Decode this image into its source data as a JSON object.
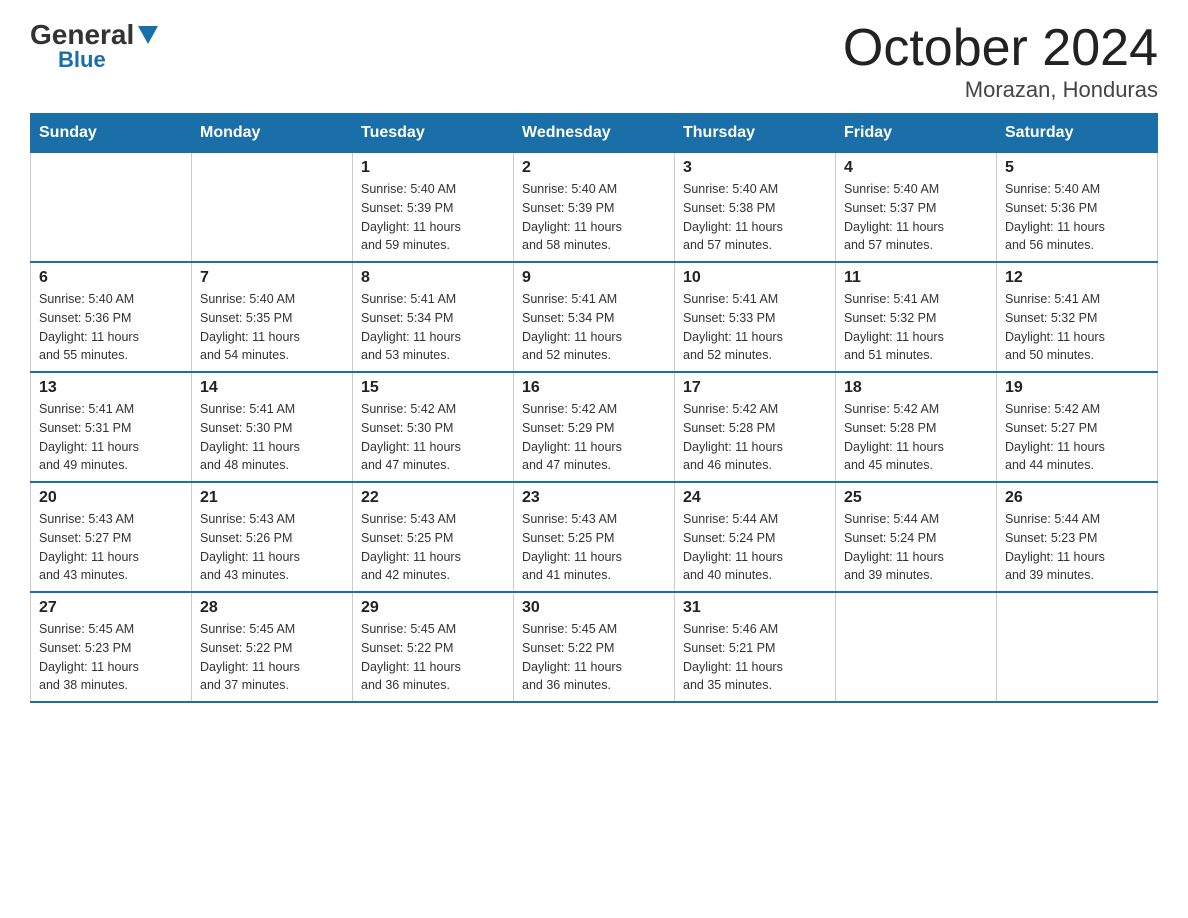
{
  "logo": {
    "general": "General",
    "blue": "Blue"
  },
  "title": "October 2024",
  "location": "Morazan, Honduras",
  "days_of_week": [
    "Sunday",
    "Monday",
    "Tuesday",
    "Wednesday",
    "Thursday",
    "Friday",
    "Saturday"
  ],
  "weeks": [
    [
      {
        "day": "",
        "info": ""
      },
      {
        "day": "",
        "info": ""
      },
      {
        "day": "1",
        "info": "Sunrise: 5:40 AM\nSunset: 5:39 PM\nDaylight: 11 hours\nand 59 minutes."
      },
      {
        "day": "2",
        "info": "Sunrise: 5:40 AM\nSunset: 5:39 PM\nDaylight: 11 hours\nand 58 minutes."
      },
      {
        "day": "3",
        "info": "Sunrise: 5:40 AM\nSunset: 5:38 PM\nDaylight: 11 hours\nand 57 minutes."
      },
      {
        "day": "4",
        "info": "Sunrise: 5:40 AM\nSunset: 5:37 PM\nDaylight: 11 hours\nand 57 minutes."
      },
      {
        "day": "5",
        "info": "Sunrise: 5:40 AM\nSunset: 5:36 PM\nDaylight: 11 hours\nand 56 minutes."
      }
    ],
    [
      {
        "day": "6",
        "info": "Sunrise: 5:40 AM\nSunset: 5:36 PM\nDaylight: 11 hours\nand 55 minutes."
      },
      {
        "day": "7",
        "info": "Sunrise: 5:40 AM\nSunset: 5:35 PM\nDaylight: 11 hours\nand 54 minutes."
      },
      {
        "day": "8",
        "info": "Sunrise: 5:41 AM\nSunset: 5:34 PM\nDaylight: 11 hours\nand 53 minutes."
      },
      {
        "day": "9",
        "info": "Sunrise: 5:41 AM\nSunset: 5:34 PM\nDaylight: 11 hours\nand 52 minutes."
      },
      {
        "day": "10",
        "info": "Sunrise: 5:41 AM\nSunset: 5:33 PM\nDaylight: 11 hours\nand 52 minutes."
      },
      {
        "day": "11",
        "info": "Sunrise: 5:41 AM\nSunset: 5:32 PM\nDaylight: 11 hours\nand 51 minutes."
      },
      {
        "day": "12",
        "info": "Sunrise: 5:41 AM\nSunset: 5:32 PM\nDaylight: 11 hours\nand 50 minutes."
      }
    ],
    [
      {
        "day": "13",
        "info": "Sunrise: 5:41 AM\nSunset: 5:31 PM\nDaylight: 11 hours\nand 49 minutes."
      },
      {
        "day": "14",
        "info": "Sunrise: 5:41 AM\nSunset: 5:30 PM\nDaylight: 11 hours\nand 48 minutes."
      },
      {
        "day": "15",
        "info": "Sunrise: 5:42 AM\nSunset: 5:30 PM\nDaylight: 11 hours\nand 47 minutes."
      },
      {
        "day": "16",
        "info": "Sunrise: 5:42 AM\nSunset: 5:29 PM\nDaylight: 11 hours\nand 47 minutes."
      },
      {
        "day": "17",
        "info": "Sunrise: 5:42 AM\nSunset: 5:28 PM\nDaylight: 11 hours\nand 46 minutes."
      },
      {
        "day": "18",
        "info": "Sunrise: 5:42 AM\nSunset: 5:28 PM\nDaylight: 11 hours\nand 45 minutes."
      },
      {
        "day": "19",
        "info": "Sunrise: 5:42 AM\nSunset: 5:27 PM\nDaylight: 11 hours\nand 44 minutes."
      }
    ],
    [
      {
        "day": "20",
        "info": "Sunrise: 5:43 AM\nSunset: 5:27 PM\nDaylight: 11 hours\nand 43 minutes."
      },
      {
        "day": "21",
        "info": "Sunrise: 5:43 AM\nSunset: 5:26 PM\nDaylight: 11 hours\nand 43 minutes."
      },
      {
        "day": "22",
        "info": "Sunrise: 5:43 AM\nSunset: 5:25 PM\nDaylight: 11 hours\nand 42 minutes."
      },
      {
        "day": "23",
        "info": "Sunrise: 5:43 AM\nSunset: 5:25 PM\nDaylight: 11 hours\nand 41 minutes."
      },
      {
        "day": "24",
        "info": "Sunrise: 5:44 AM\nSunset: 5:24 PM\nDaylight: 11 hours\nand 40 minutes."
      },
      {
        "day": "25",
        "info": "Sunrise: 5:44 AM\nSunset: 5:24 PM\nDaylight: 11 hours\nand 39 minutes."
      },
      {
        "day": "26",
        "info": "Sunrise: 5:44 AM\nSunset: 5:23 PM\nDaylight: 11 hours\nand 39 minutes."
      }
    ],
    [
      {
        "day": "27",
        "info": "Sunrise: 5:45 AM\nSunset: 5:23 PM\nDaylight: 11 hours\nand 38 minutes."
      },
      {
        "day": "28",
        "info": "Sunrise: 5:45 AM\nSunset: 5:22 PM\nDaylight: 11 hours\nand 37 minutes."
      },
      {
        "day": "29",
        "info": "Sunrise: 5:45 AM\nSunset: 5:22 PM\nDaylight: 11 hours\nand 36 minutes."
      },
      {
        "day": "30",
        "info": "Sunrise: 5:45 AM\nSunset: 5:22 PM\nDaylight: 11 hours\nand 36 minutes."
      },
      {
        "day": "31",
        "info": "Sunrise: 5:46 AM\nSunset: 5:21 PM\nDaylight: 11 hours\nand 35 minutes."
      },
      {
        "day": "",
        "info": ""
      },
      {
        "day": "",
        "info": ""
      }
    ]
  ]
}
